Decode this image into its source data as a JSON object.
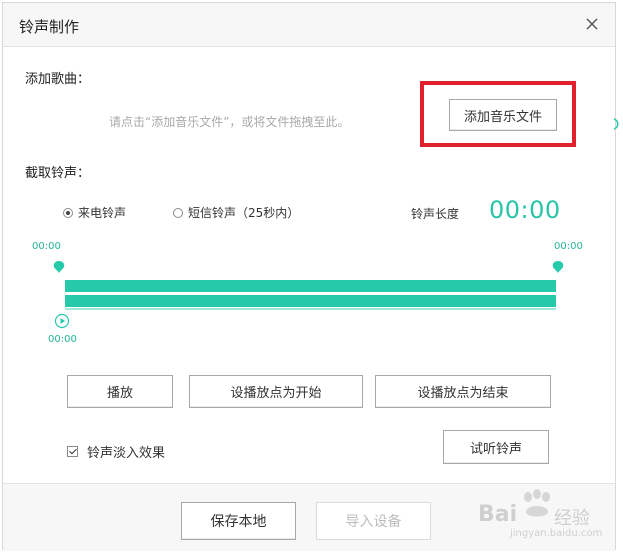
{
  "dialog": {
    "title": "铃声制作"
  },
  "add_song": {
    "section_label": "添加歌曲：",
    "hint": "请点击“添加音乐文件”，或将文件拖拽至此。",
    "add_button_label": "添加音乐文件"
  },
  "trim": {
    "section_label": "截取铃声：",
    "radio_options": [
      {
        "label": "来电铃声",
        "selected": true
      },
      {
        "label": "短信铃声（25秒内）",
        "selected": false
      }
    ],
    "length_label": "铃声长度",
    "length_value": "00:00",
    "start_time": "00:00",
    "end_time": "00:00",
    "play_time": "00:00"
  },
  "controls": {
    "play_label": "播放",
    "set_start_label": "设播放点为开始",
    "set_end_label": "设播放点为结束",
    "fade_in_label": "铃声淡入效果",
    "fade_in_checked": true,
    "preview_label": "试听铃声"
  },
  "footer": {
    "save_local_label": "保存本地",
    "import_device_label": "导入设备"
  },
  "watermark": {
    "brand": "Bai",
    "brand_suffix": "经验",
    "url": "jingyan.baidu.com"
  },
  "colors": {
    "accent": "#27c9ab",
    "highlight": "#e0202a"
  }
}
